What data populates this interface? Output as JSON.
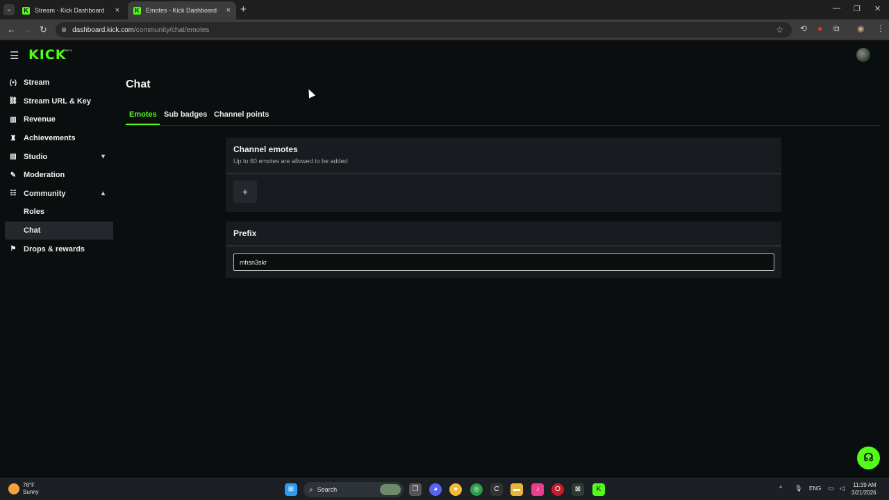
{
  "browser": {
    "tabs": [
      {
        "title": "Stream - Kick Dashboard",
        "active": false
      },
      {
        "title": "Emotes - Kick Dashboard",
        "active": true
      }
    ],
    "url_host": "dashboard.kick.com",
    "url_path": "/community/chat/emotes"
  },
  "header": {
    "logo": "KICK",
    "logo_badge": "BETA"
  },
  "sidebar": {
    "items": [
      {
        "label": "Stream",
        "icon": "broadcast-icon"
      },
      {
        "label": "Stream URL & Key",
        "icon": "link-icon"
      },
      {
        "label": "Revenue",
        "icon": "chart-icon"
      },
      {
        "label": "Achievements",
        "icon": "trophy-icon"
      },
      {
        "label": "Studio",
        "icon": "studio-icon"
      },
      {
        "label": "Moderation",
        "icon": "wrench-icon"
      },
      {
        "label": "Community",
        "icon": "community-icon"
      },
      {
        "label": "Roles",
        "icon": ""
      },
      {
        "label": "Chat",
        "icon": ""
      },
      {
        "label": "Drops & rewards",
        "icon": "drops-icon"
      }
    ]
  },
  "main": {
    "title": "Chat",
    "tabs": [
      {
        "label": "Emotes",
        "active": true
      },
      {
        "label": "Sub badges",
        "active": false
      },
      {
        "label": "Channel points",
        "active": false
      }
    ],
    "emotes_card": {
      "title": "Channel emotes",
      "subtitle": "Up to 60 emotes are allowed to be added",
      "add_label": "+"
    },
    "prefix_card": {
      "title": "Prefix",
      "value": "mhsn3skr"
    }
  },
  "taskbar": {
    "weather_temp": "76°F",
    "weather_desc": "Sunny",
    "search_label": "Search",
    "lang": "ENG",
    "time": "11:39 AM",
    "date": "3/21/2026"
  },
  "colors": {
    "accent": "#53fc18",
    "background": "#0b0e0f",
    "card": "#181b1f"
  }
}
